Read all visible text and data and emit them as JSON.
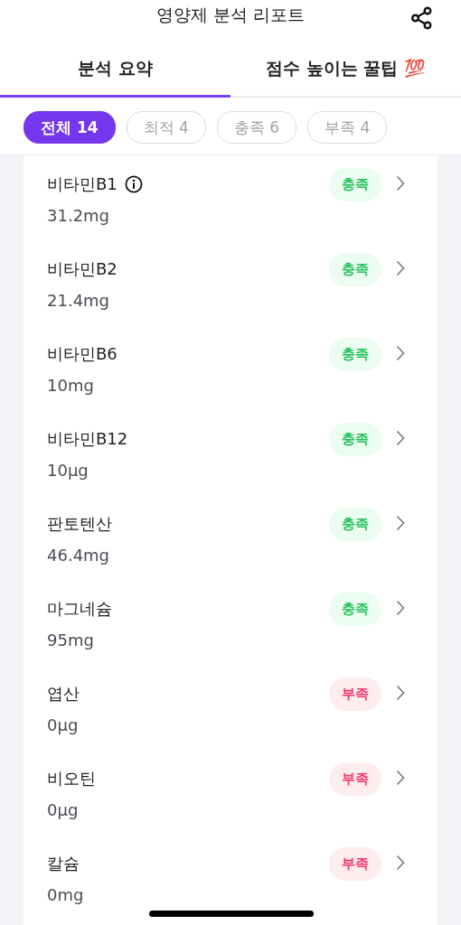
{
  "header": {
    "title": "영양제 분석 리포트"
  },
  "tabs": [
    {
      "label": "분석 요약",
      "selected": true
    },
    {
      "label": "점수 높이는 꿀팁 💯",
      "selected": false
    }
  ],
  "filters": [
    {
      "label": "전체 14",
      "selected": true
    },
    {
      "label": "최적 4",
      "selected": false
    },
    {
      "label": "충족 6",
      "selected": false
    },
    {
      "label": "부족 4",
      "selected": false
    }
  ],
  "nutrients": [
    {
      "name": "비타민B1",
      "info": true,
      "amount": "31.2mg",
      "kind": "sufficient",
      "badge": "충족"
    },
    {
      "name": "비타민B2",
      "info": false,
      "amount": "21.4mg",
      "kind": "sufficient",
      "badge": "충족"
    },
    {
      "name": "비타민B6",
      "info": false,
      "amount": "10mg",
      "kind": "sufficient",
      "badge": "충족"
    },
    {
      "name": "비타민B12",
      "info": false,
      "amount": "10μg",
      "kind": "sufficient",
      "badge": "충족"
    },
    {
      "name": "판토텐산",
      "info": false,
      "amount": "46.4mg",
      "kind": "sufficient",
      "badge": "충족"
    },
    {
      "name": "마그네슘",
      "info": false,
      "amount": "95mg",
      "kind": "sufficient",
      "badge": "충족"
    },
    {
      "name": "엽산",
      "info": false,
      "amount": "0μg",
      "kind": "deficient",
      "badge": "부족"
    },
    {
      "name": "비오틴",
      "info": false,
      "amount": "0μg",
      "kind": "deficient",
      "badge": "부족"
    },
    {
      "name": "칼슘",
      "info": false,
      "amount": "0mg",
      "kind": "deficient",
      "badge": "부족"
    }
  ]
}
